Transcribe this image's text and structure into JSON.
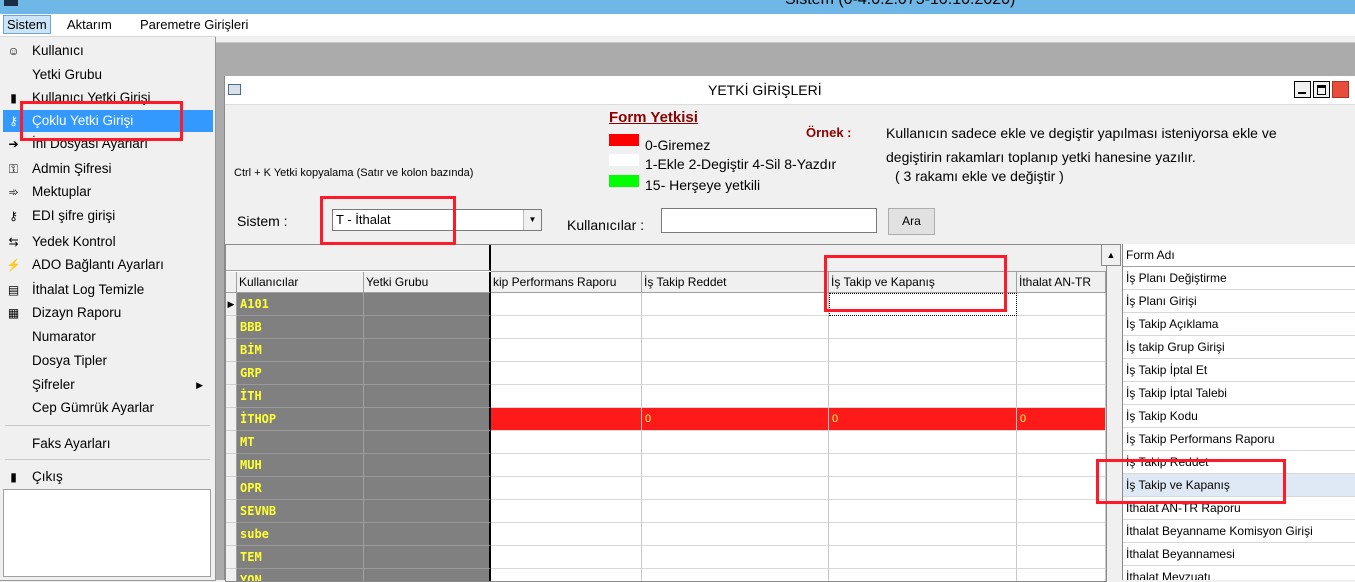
{
  "app": {
    "title": "Sistem (0-4.0.2.075-10.10.2020)"
  },
  "menubar": {
    "items": [
      "Sistem",
      "Aktarım",
      "Paremetre Girişleri"
    ]
  },
  "sistem_menu": {
    "items": [
      {
        "label": "Kullanıcı",
        "icon": "user-icon"
      },
      {
        "label": "Yetki Grubu",
        "icon": ""
      },
      {
        "label": "Kullanıcı Yetki Girişi",
        "icon": "door-icon"
      },
      {
        "label": "Çoklu Yetki Girişi",
        "icon": "keys-icon",
        "selected": true
      },
      {
        "label": "İni Dosyası Ayarları",
        "icon": "file-arrow-icon"
      },
      {
        "label": "Admin Şifresi",
        "icon": "key-icon"
      },
      {
        "label": "Mektuplar",
        "icon": "arrow-icon"
      },
      {
        "label": "EDI şifre girişi",
        "icon": "keys-icon"
      },
      {
        "label": "Yedek Kontrol",
        "icon": "backup-icon"
      },
      {
        "label": "ADO Bağlantı Ayarları",
        "icon": "plug-icon"
      },
      {
        "label": "İthalat Log Temizle",
        "icon": "log-icon"
      },
      {
        "label": "Dizayn Raporu",
        "icon": "report-icon"
      },
      {
        "label": "Numarator",
        "icon": ""
      },
      {
        "label": "Dosya Tipler",
        "icon": ""
      },
      {
        "label": "Şifreler",
        "icon": "",
        "submenu": true
      },
      {
        "label": "Cep Gümrük Ayarlar",
        "icon": ""
      },
      {
        "label": "Faks Ayarları",
        "icon": ""
      },
      {
        "label": "Çıkış",
        "icon": "exit-icon"
      }
    ]
  },
  "window": {
    "title": "YETKİ GİRİŞLERİ"
  },
  "legend": {
    "title": "Form Yetkisi",
    "items": [
      {
        "label": "0-Giremez",
        "color": "#ff0000"
      },
      {
        "label": "1-Ekle 2-Degiştir 4-Sil 8-Yazdır",
        "color": "#ffffff"
      },
      {
        "label": "15- Herşeye yetkili",
        "color": "#00ff00"
      }
    ]
  },
  "example": {
    "label": "Örnek :",
    "lines": [
      "Kullanıcın sadece ekle ve degiştir yapılması isteniyorsa  ekle ve",
      "degiştirin rakamları toplanıp yetki hanesine yazılır.",
      "( 3 rakamı ekle ve değiştir )"
    ]
  },
  "hint": "Ctrl + K Yetki kopyalama (Satır ve kolon bazında)",
  "filters": {
    "sistem_label": "Sistem :",
    "sistem_value": "T - İthalat",
    "kullanicilar_label": "Kullanıcılar :",
    "kullanicilar_value": "",
    "ara_label": "Ara"
  },
  "grid": {
    "columns": [
      "Kullanıcılar",
      "Yetki Grubu",
      "kip Performans Raporu",
      "İş Takip Reddet",
      "İş Takip ve Kapanış",
      "İthalat AN-TR"
    ],
    "rows": [
      {
        "code": "A101",
        "values": [
          "",
          "",
          "",
          ""
        ],
        "current": true
      },
      {
        "code": "BBB",
        "values": [
          "",
          "",
          "",
          ""
        ]
      },
      {
        "code": "BİM",
        "values": [
          "",
          "",
          "",
          ""
        ]
      },
      {
        "code": "GRP",
        "values": [
          "",
          "",
          "",
          ""
        ]
      },
      {
        "code": "İTH",
        "values": [
          "",
          "",
          "",
          ""
        ]
      },
      {
        "code": "İTHOP",
        "values": [
          "",
          "0",
          "0",
          "0"
        ],
        "red": true
      },
      {
        "code": "MT",
        "values": [
          "",
          "",
          "",
          ""
        ]
      },
      {
        "code": "MUH",
        "values": [
          "",
          "",
          "",
          ""
        ]
      },
      {
        "code": "OPR",
        "values": [
          "",
          "",
          "",
          ""
        ]
      },
      {
        "code": "SEVNB",
        "values": [
          "",
          "",
          "",
          ""
        ]
      },
      {
        "code": "sube",
        "values": [
          "",
          "",
          "",
          ""
        ]
      },
      {
        "code": "TEM",
        "values": [
          "",
          "",
          "",
          ""
        ]
      },
      {
        "code": "YON",
        "values": [
          "",
          "",
          "",
          ""
        ]
      }
    ]
  },
  "form_list": {
    "header": "Form Adı",
    "items": [
      "İş Planı Değiştirme",
      "İş Planı Girişi",
      "İş Takip Açıklama",
      "İş takip Grup Girişi",
      "İş Takip İptal Et",
      "İş Takip İptal Talebi",
      "İş Takip Kodu",
      "İş Takip Performans Raporu",
      "İş Takip Reddet",
      "İş Takip ve Kapanış",
      "İthalat AN-TR Raporu",
      "İthalat Beyanname Komisyon Girişi",
      "İthalat Beyannamesi",
      "İthalat Mevzuatı"
    ],
    "highlighted_index": 9
  }
}
